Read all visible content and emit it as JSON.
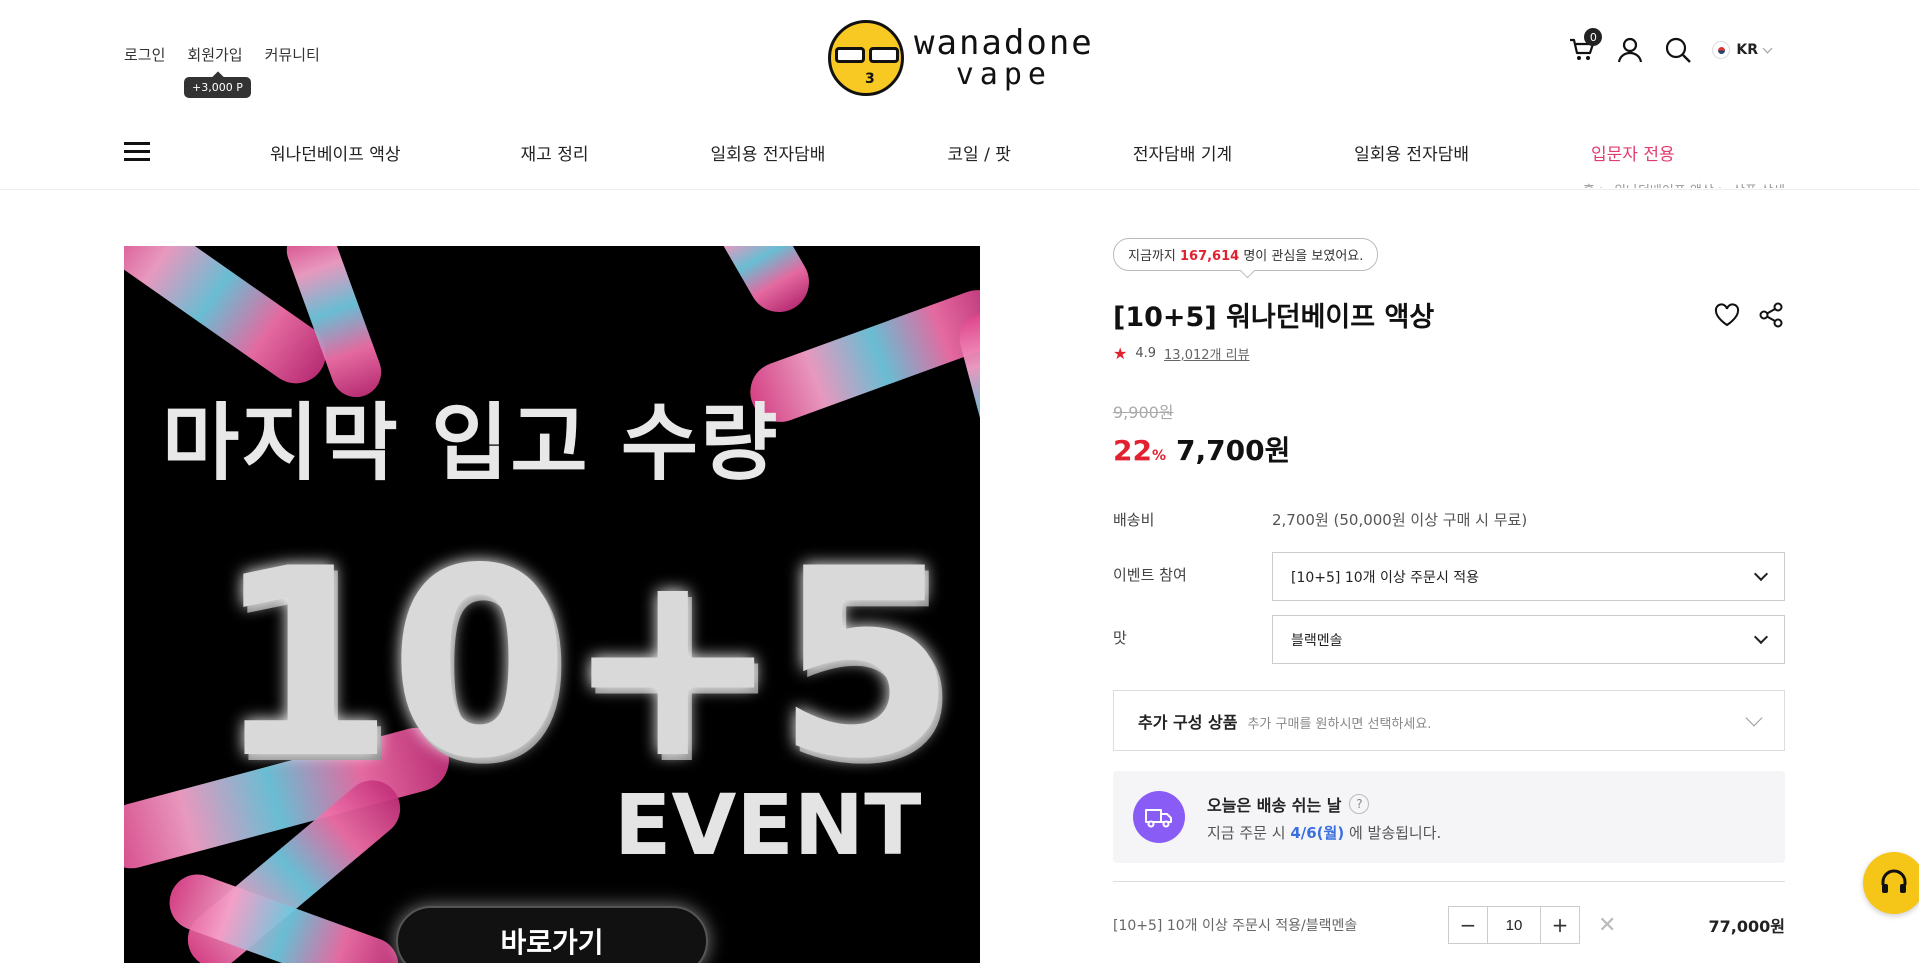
{
  "header": {
    "links": [
      "로그인",
      "회원가입",
      "커뮤니티"
    ],
    "points_tip": "+3,000 P",
    "logo_line1": "wanadone",
    "logo_line2": "vape",
    "cart_count": "0",
    "language": "KR"
  },
  "nav": {
    "items": [
      "워나던베이프 액상",
      "재고 정리",
      "일회용 전자담배",
      "코일 / 팟",
      "전자담배 기계",
      "일회용 전자담배",
      "입문자 전용"
    ],
    "accent_color": "#e23c6e"
  },
  "image": {
    "headline": "마지막 입고 수량",
    "big_text": "10+5",
    "event_text": "EVENT",
    "button_label": "바로가기"
  },
  "product": {
    "interest_prefix": "지금까지 ",
    "interest_count": "167,614",
    "interest_suffix": " 명이 관심을 보였어요.",
    "title": "[10+5] 워나던베이프 액상",
    "rating": "4.9",
    "review_count": "13,012개 리뷰",
    "original_price": "9,900원",
    "discount": "22",
    "discount_unit": "%",
    "sale_price": "7,700원"
  },
  "options": {
    "shipping_label": "배송비",
    "shipping_value": "2,700원 (50,000원 이상 구매 시 무료)",
    "event_label": "이벤트 참여",
    "event_selected": "[10+5] 10개 이상 주문시 적용",
    "flavor_label": "맛",
    "flavor_selected": "블랙멘솔",
    "addon_title": "추가 구성 상품",
    "addon_sub": "추가 구매를 원하시면 선택하세요."
  },
  "shipping_notice": {
    "title": "오늘은 배송 쉬는 날",
    "help": "?",
    "desc_prefix": "지금 주문 시 ",
    "date": "4/6(월)",
    "desc_suffix": " 에 발송됩니다."
  },
  "cart_line": {
    "name": "[10+5] 10개 이상 주문시 적용/블랙멘솔",
    "quantity": "10",
    "minus": "−",
    "plus": "+",
    "remove": "✕",
    "price": "77,000원"
  },
  "colors": {
    "sale_red": "#e3202f",
    "shipping_purple": "#8a5cf6",
    "date_blue": "#3b6fe0",
    "cs_yellow": "#f5c518"
  },
  "icons": [
    "cart-icon",
    "user-icon",
    "search-icon",
    "heart-icon",
    "share-icon",
    "truck-icon",
    "headset-icon",
    "chevron-down-icon",
    "star-icon"
  ]
}
